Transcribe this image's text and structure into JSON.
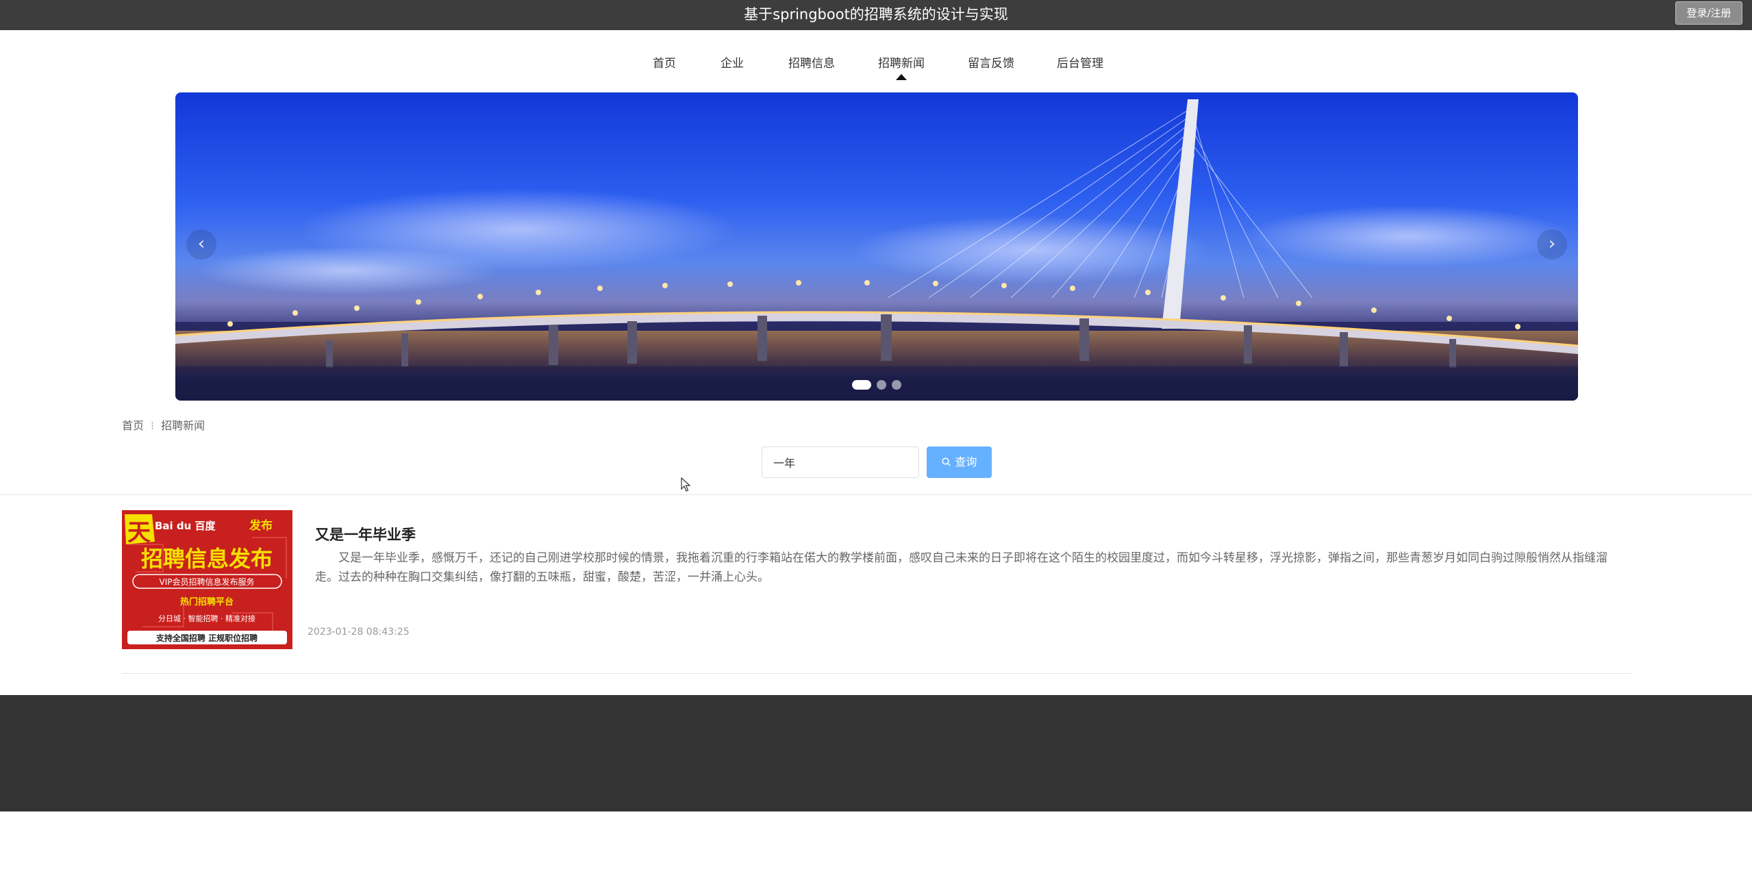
{
  "header": {
    "site_title": "基于springboot的招聘系统的设计与实现",
    "login_label": "登录/注册"
  },
  "nav": {
    "items": [
      {
        "label": "首页"
      },
      {
        "label": "企业"
      },
      {
        "label": "招聘信息"
      },
      {
        "label": "招聘新闻"
      },
      {
        "label": "留言反馈"
      },
      {
        "label": "后台管理"
      }
    ],
    "active": "招聘新闻"
  },
  "banner": {
    "prev_glyph": "‹",
    "next_glyph": "›",
    "slide_count": 3,
    "active_slide": 1
  },
  "breadcrumb": {
    "home": "首页",
    "separator": "⁝",
    "current": "招聘新闻"
  },
  "search": {
    "value": "一年",
    "button_label": "查询",
    "button_icon": "search-icon"
  },
  "news": [
    {
      "title": "又是一年毕业季",
      "summary": "又是一年毕业季，感慨万千，还记的自己刚进学校那时候的情景，我拖着沉重的行李箱站在偌大的教学楼前面，感叹自己未来的日子即将在这个陌生的校园里度过，而如今斗转星移，浮光掠影，弹指之间，那些青葱岁月如同白驹过隙般悄然从指缝溜走。过去的种种在胸口交集纠结，像打翻的五味瓶，甜蜜，酸楚，苦涩，一并涌上心头。",
      "time": "2023-01-28 08:43:25",
      "thumb": {
        "brand": "Bai du 百度",
        "badge": "发布",
        "headline": "招聘信息发布",
        "line1": "VIP会员招聘信息发布服务",
        "line2": "热门招聘平台",
        "line3": "分日城 · 智能招聘 · 精准对接",
        "line4": "支持全国招聘  正规职位招聘"
      }
    }
  ],
  "colors": {
    "topbar": "#3d3d3d",
    "footer": "#333333",
    "search_button": "#66b1ff",
    "thumb_red": "#c8201e"
  }
}
